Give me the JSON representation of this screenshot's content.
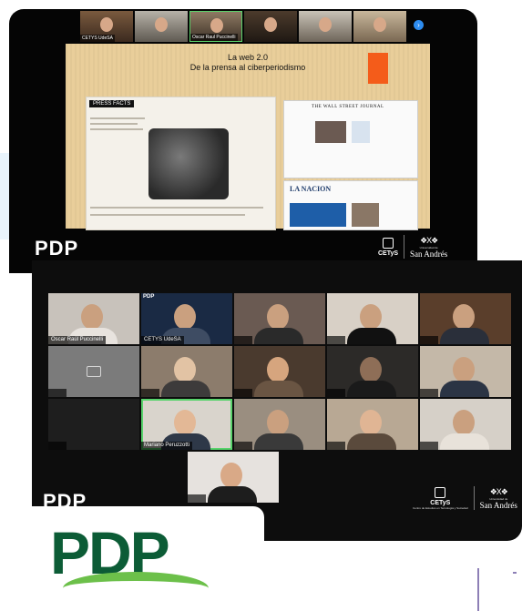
{
  "brand": {
    "logo_text": "PDP",
    "cetys": "CETyS",
    "cetys_sub": "Centro de Estudios en Tecnología y Sociedad",
    "sa_sub": "Universidad de",
    "sa": "San Andrés"
  },
  "top": {
    "strip": [
      {
        "name": "CETYS UdeSA"
      },
      {
        "name": ""
      },
      {
        "name": "Oscar Raul Puccinelli"
      },
      {
        "name": ""
      },
      {
        "name": ""
      },
      {
        "name": ""
      }
    ],
    "slide": {
      "title_line1": "La web 2.0",
      "title_line2": "De la prensa al ciberperiodismo",
      "poster_title": "PRESS FACTS",
      "wsj_masthead": "THE WALL STREET JOURNAL",
      "lanacion_masthead": "LA NACION"
    }
  },
  "bottom": {
    "tiles": [
      {
        "label": "Oscar Raúl Puccinelli"
      },
      {
        "label": "CETYS UdeSA",
        "badge": "PDP"
      },
      {
        "label": ""
      },
      {
        "label": ""
      },
      {
        "label": ""
      },
      {
        "label": ""
      },
      {
        "label": ""
      },
      {
        "label": ""
      },
      {
        "label": ""
      },
      {
        "label": ""
      },
      {
        "label": ""
      },
      {
        "label": "Mariano Peruzzotti"
      },
      {
        "label": ""
      },
      {
        "label": ""
      },
      {
        "label": ""
      },
      {
        "label": ""
      }
    ]
  }
}
